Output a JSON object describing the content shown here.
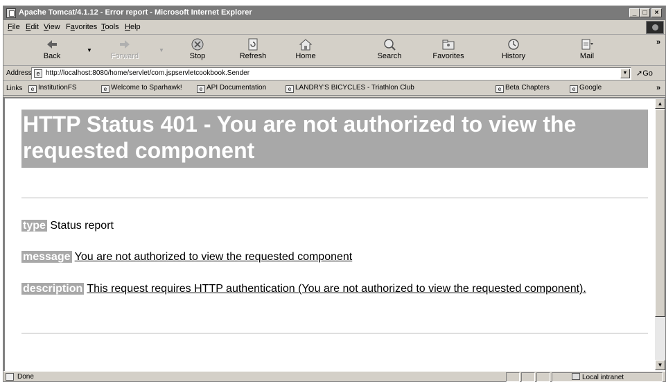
{
  "window": {
    "title": "Apache Tomcat/4.1.12 - Error report - Microsoft Internet Explorer",
    "controls": {
      "minimize": "_",
      "maximize": "□",
      "close": "×"
    }
  },
  "menu": {
    "items": [
      {
        "first": "F",
        "rest": "ile"
      },
      {
        "first": "E",
        "rest": "dit"
      },
      {
        "first": "V",
        "rest": "iew"
      },
      {
        "pre": "F",
        "first": "a",
        "rest": "vorites"
      },
      {
        "first": "T",
        "rest": "ools"
      },
      {
        "first": "H",
        "rest": "elp"
      }
    ]
  },
  "toolbar": {
    "back": "Back",
    "forward": "Forward",
    "stop": "Stop",
    "refresh": "Refresh",
    "home": "Home",
    "search": "Search",
    "favorites": "Favorites",
    "history": "History",
    "mail": "Mail",
    "overflow": "»"
  },
  "address": {
    "label": "Address",
    "url": "http://localhost:8080/home/servlet/com.jspservletcookbook.Sender",
    "go": "Go"
  },
  "links": {
    "label": "Links",
    "items": [
      "InstitutionFS",
      "Welcome to Sparhawk!",
      "API Documentation",
      "LANDRY'S BICYCLES - Triathlon Club",
      "Beta Chapters",
      "Google"
    ],
    "overflow": "»"
  },
  "page": {
    "title": "HTTP Status 401 - You are not authorized to view the requested component",
    "type_key": "type",
    "type_value": "Status report",
    "message_key": "message",
    "message_value": "You are not authorized to view the requested component",
    "description_key": "description",
    "description_value": "This request requires HTTP authentication (You are not authorized to view the requested component)."
  },
  "status": {
    "text": "Done",
    "zone": "Local intranet"
  }
}
